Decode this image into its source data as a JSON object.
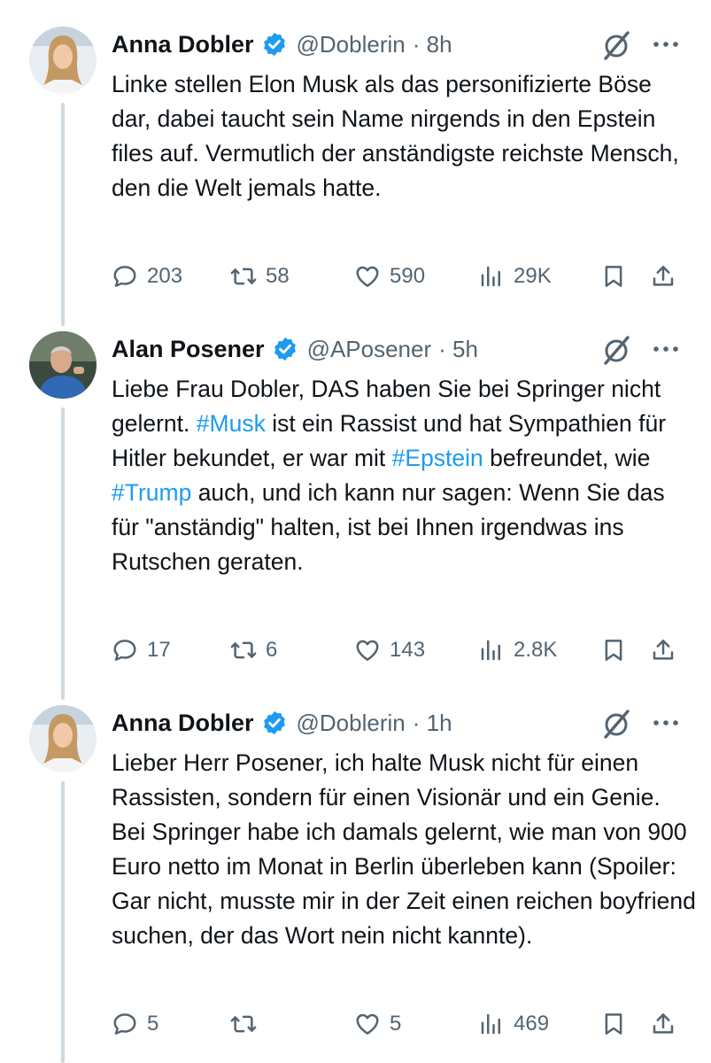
{
  "colors": {
    "link": "#1d9bf0",
    "verified": "#1d9bf0",
    "muted": "#536471",
    "thread": "#cfd9de"
  },
  "tweets": [
    {
      "name": "Anna Dobler",
      "handle": "@Doblerin",
      "time": "· 8h",
      "text": "Linke stellen Elon Musk als das personifizierte Böse dar, dabei taucht sein Name nirgends in den Epstein files auf. Vermutlich der anständigste reichste Mensch, den die Welt jemals hatte.",
      "replies": "203",
      "reposts": "58",
      "likes": "590",
      "views": "29K"
    },
    {
      "name": "Alan Posener",
      "handle": "@APosener",
      "time": "· 5h",
      "text_parts": [
        "Liebe Frau Dobler, DAS haben Sie bei Springer nicht gelernt. ",
        "#Musk",
        " ist ein Rassist und hat Sympathien für Hitler bekundet, er war mit ",
        "#Epstein",
        " befreundet, wie ",
        "#Trump",
        " auch, und ich kann nur sagen: Wenn Sie das für \"anständig\" halten, ist bei Ihnen irgendwas ins Rutschen geraten."
      ],
      "replies": "17",
      "reposts": "6",
      "likes": "143",
      "views": "2.8K"
    },
    {
      "name": "Anna Dobler",
      "handle": "@Doblerin",
      "time": "· 1h",
      "text": "Lieber Herr Posener, ich halte Musk nicht für einen Rassisten, sondern für einen Visionär und ein Genie. Bei Springer habe ich damals gelernt, wie man von 900 Euro netto im Monat in Berlin überleben kann (Spoiler: Gar nicht, musste mir in der Zeit einen reichen boyfriend suchen, der das Wort nein nicht kannte).",
      "replies": "5",
      "likes": "5",
      "views": "469"
    }
  ]
}
